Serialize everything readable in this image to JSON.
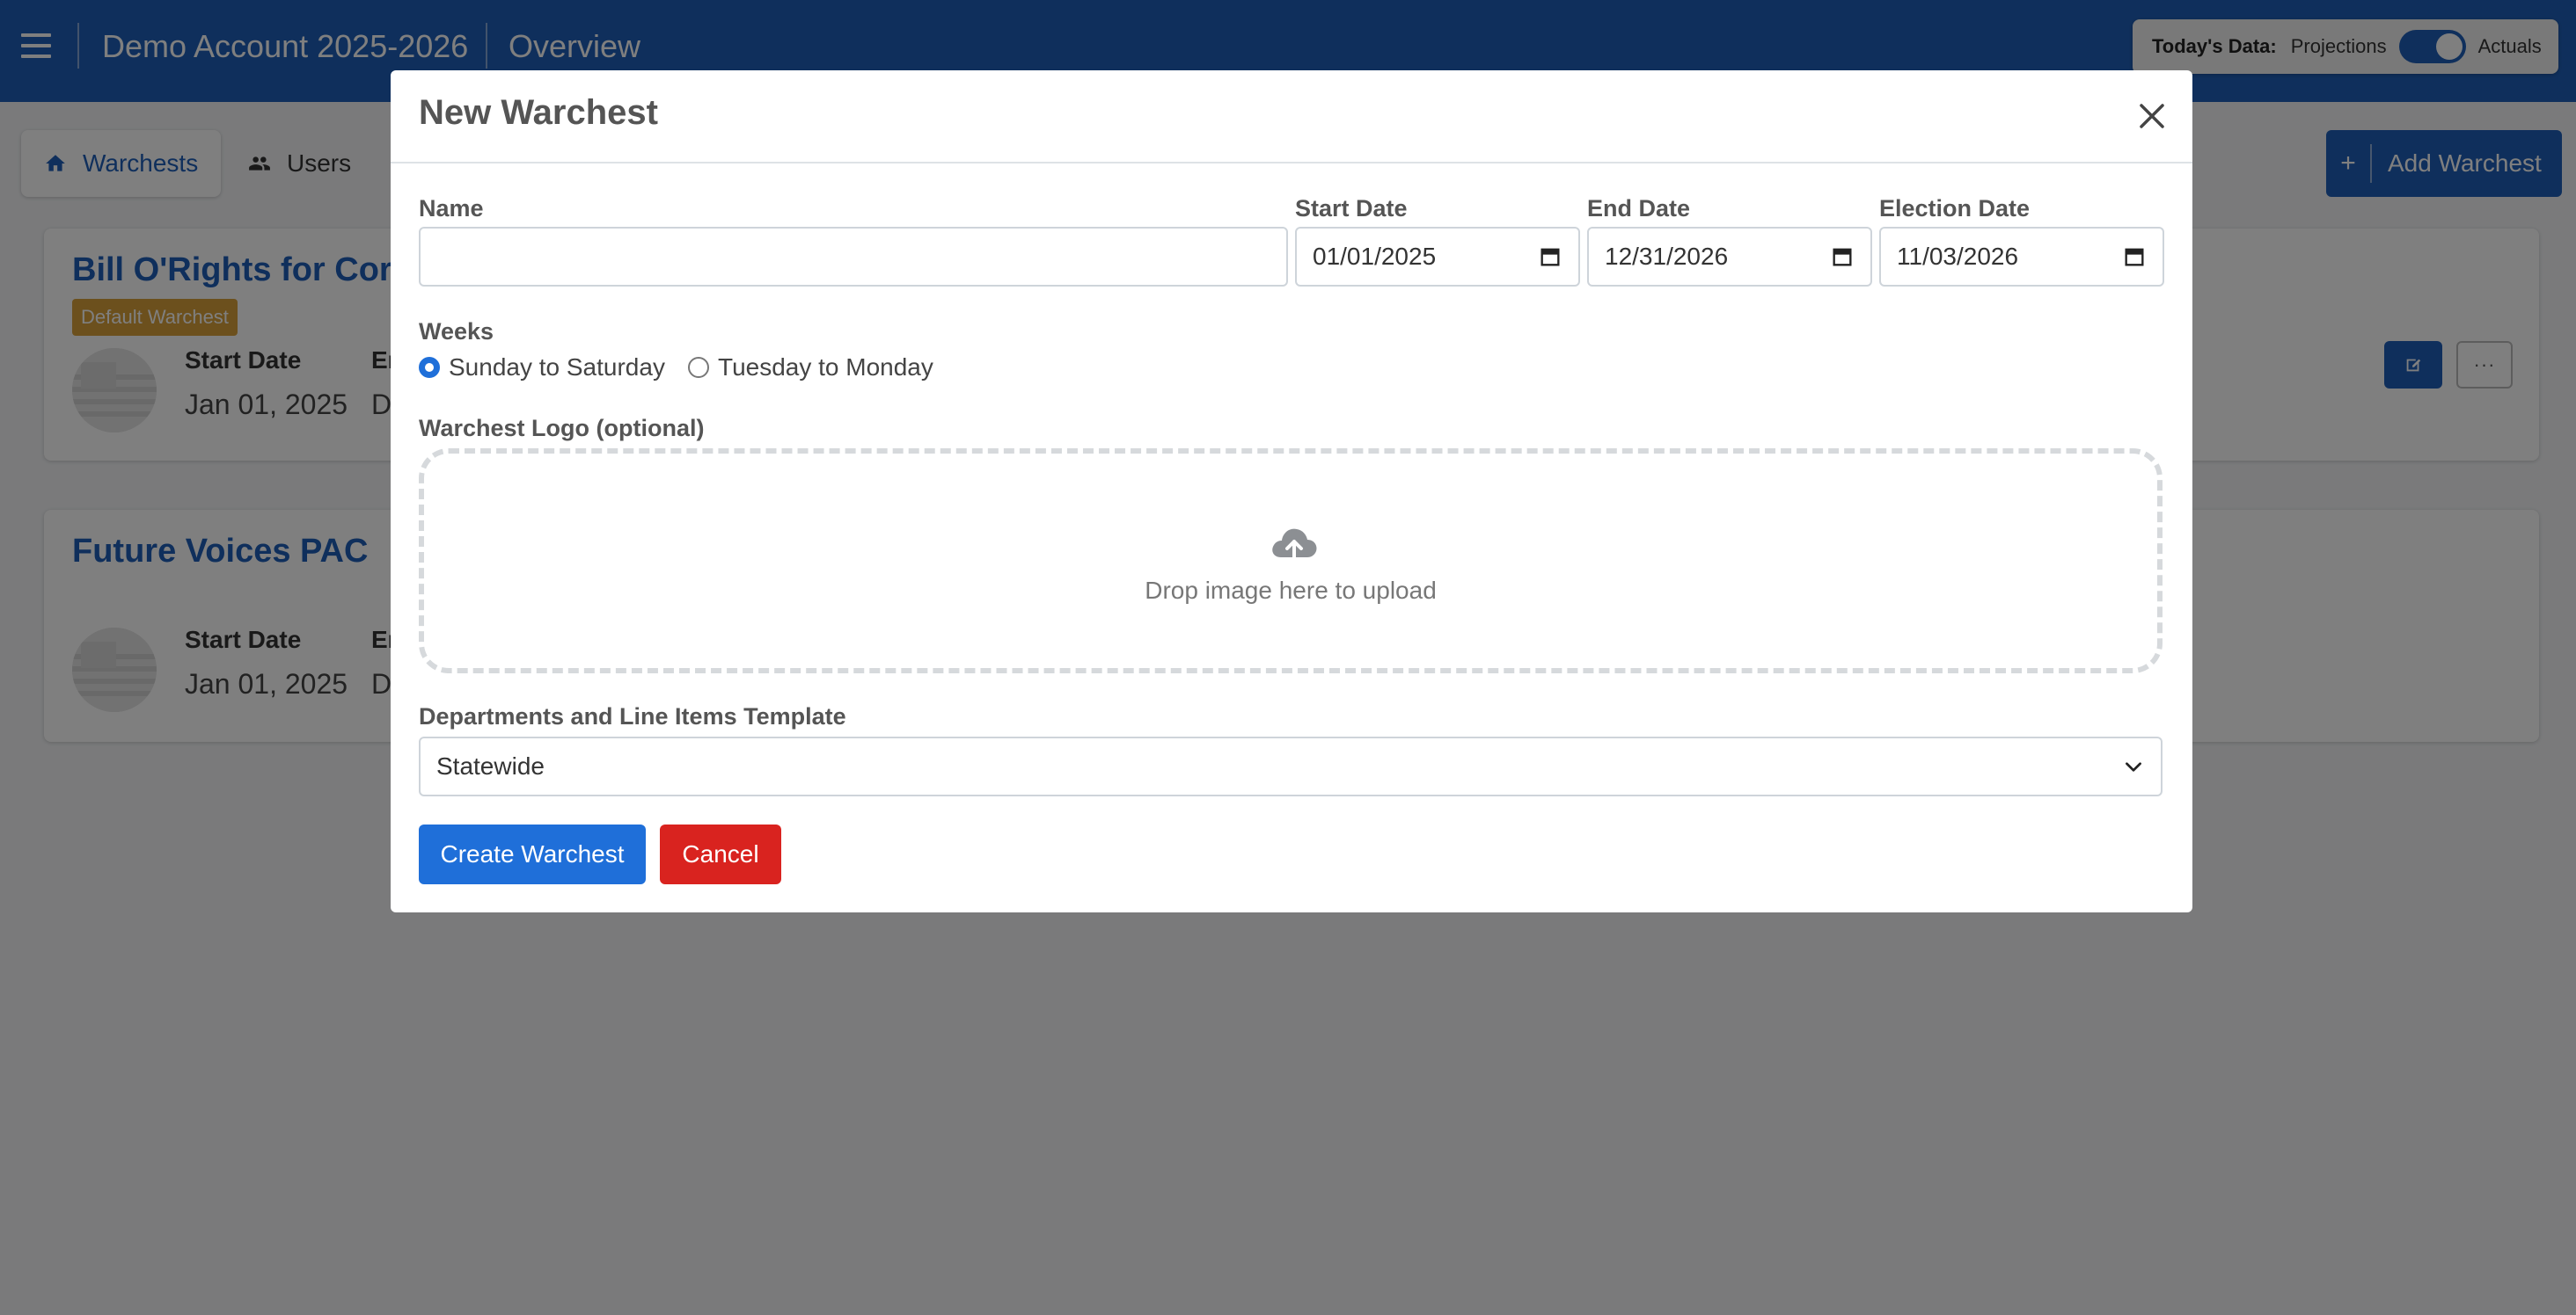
{
  "app": {
    "account_title": "Demo Account 2025-2026",
    "page_title": "Overview",
    "data_toggle": {
      "label": "Today's Data:",
      "option_left": "Projections",
      "option_right": "Actuals",
      "selected": "Actuals"
    }
  },
  "tabs": [
    {
      "label": "Warchests",
      "icon": "home-icon",
      "active": true
    },
    {
      "label": "Users",
      "icon": "users-icon",
      "active": false
    }
  ],
  "add_button": {
    "label": "Add Warchest",
    "icon": "plus-icon"
  },
  "cards": [
    {
      "title": "Bill O'Rights for Cor",
      "badge": "Default Warchest",
      "start_label": "Start Date",
      "start_value": "Jan 01, 2025",
      "end_label": "En",
      "end_value": "D"
    },
    {
      "title": "Future Voices PAC",
      "start_label": "Start Date",
      "start_value": "Jan 01, 2025",
      "end_label": "En",
      "end_value": "D"
    }
  ],
  "modal": {
    "title": "New Warchest",
    "name": {
      "label": "Name",
      "value": "",
      "placeholder": ""
    },
    "start_date": {
      "label": "Start Date",
      "value": "01/01/2025"
    },
    "end_date": {
      "label": "End Date",
      "value": "12/31/2026"
    },
    "election_date": {
      "label": "Election Date",
      "value": "11/03/2026"
    },
    "weeks": {
      "label": "Weeks",
      "options": [
        "Sunday to Saturday",
        "Tuesday to Monday"
      ],
      "selected": "Sunday to Saturday"
    },
    "logo": {
      "label": "Warchest Logo (optional)",
      "dropzone_text": "Drop image here to upload",
      "icon": "cloud-upload-icon"
    },
    "template": {
      "label": "Departments and Line Items Template",
      "selected": "Statewide"
    },
    "create_label": "Create Warchest",
    "cancel_label": "Cancel"
  },
  "colors": {
    "brand_blue": "#1f5fb8",
    "primary_button": "#1f6fd9",
    "danger_button": "#d9231f",
    "badge": "#d9a13a"
  }
}
